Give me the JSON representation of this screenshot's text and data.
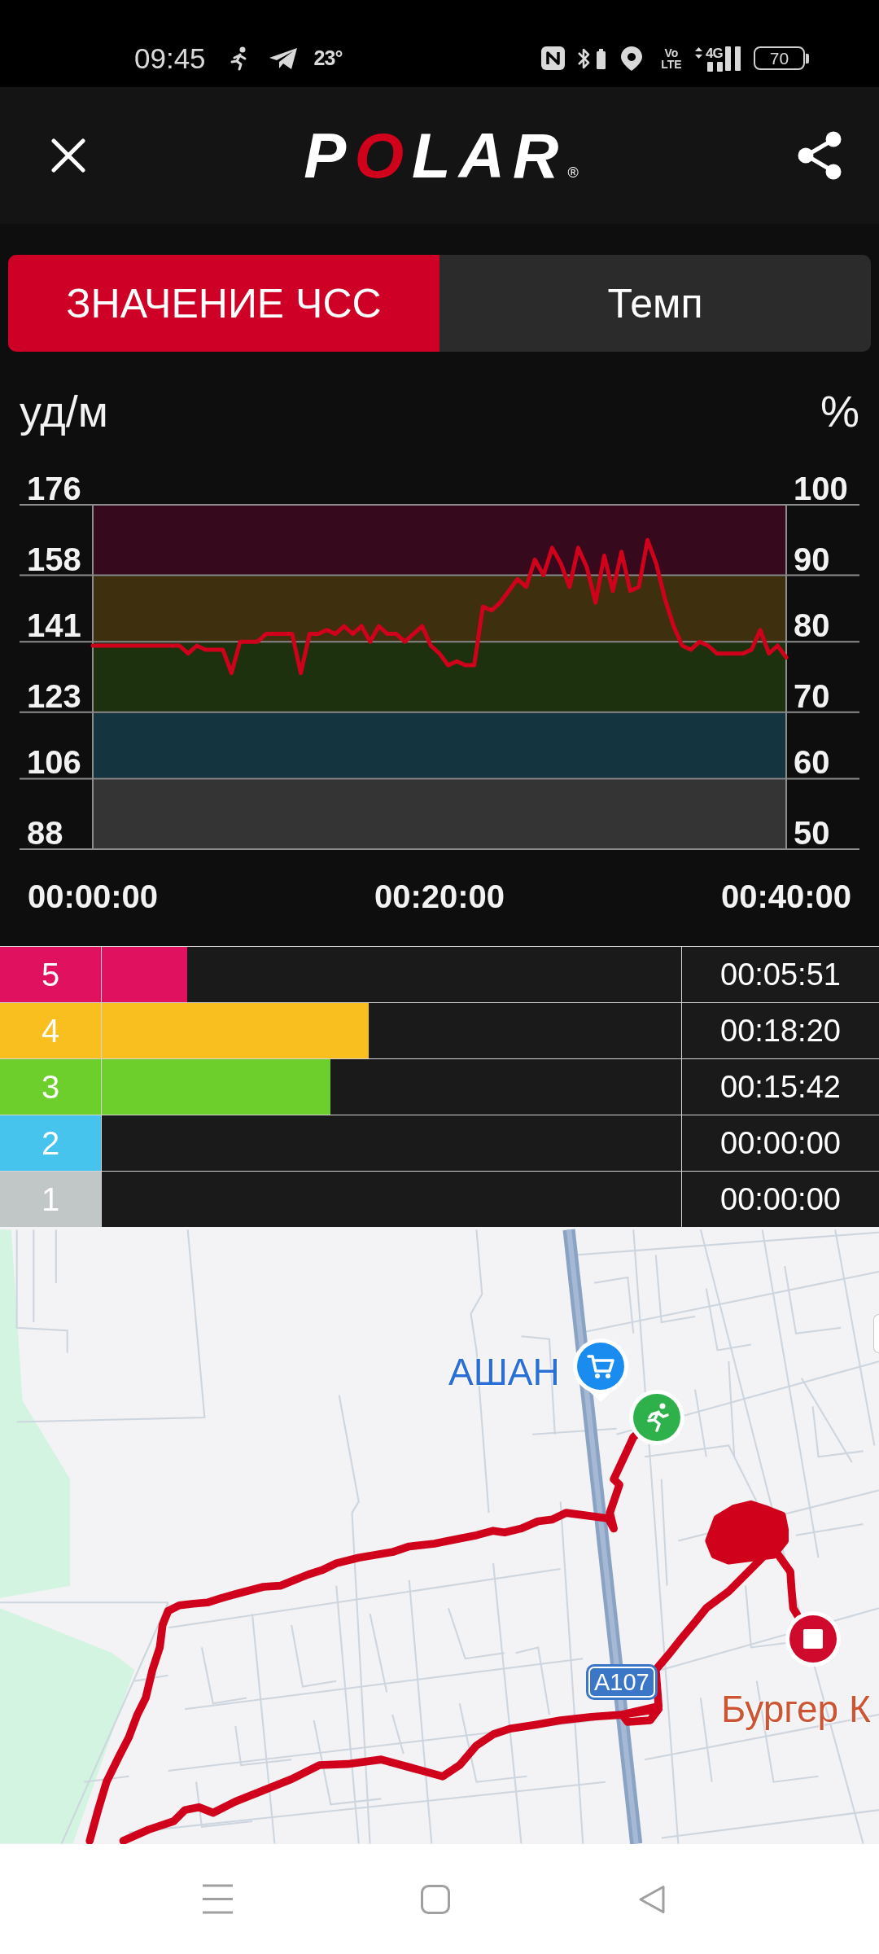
{
  "status_bar": {
    "time": "09:45",
    "temperature": "23°",
    "volte": "Vo LTE",
    "network": "4G",
    "battery": "70"
  },
  "header": {
    "logo": {
      "parts": [
        {
          "text": "P",
          "color": "#ffffff"
        },
        {
          "text": "O",
          "color": "#d0021b"
        },
        {
          "text": "LAR",
          "color": "#ffffff"
        }
      ],
      "mark": "®"
    }
  },
  "tabs": [
    {
      "label": "ЗНАЧЕНИЕ ЧСС",
      "selected": true
    },
    {
      "label": "Темп",
      "selected": false
    }
  ],
  "hr_chart": {
    "right_axis": {
      "label": "%",
      "ticks": [
        "100",
        "90",
        "80",
        "70",
        "60",
        "50"
      ]
    },
    "chart_data": {
      "type": "line",
      "ylabel": "уд/м",
      "x": [
        0,
        0.5,
        1,
        1.5,
        2,
        2.5,
        3,
        3.5,
        4,
        4.5,
        5,
        5.5,
        6,
        6.5,
        7,
        7.5,
        8,
        8.5,
        9,
        9.5,
        10,
        10.5,
        11,
        11.5,
        12,
        12.5,
        13,
        13.5,
        14,
        14.5,
        15,
        15.5,
        16,
        16.5,
        17,
        17.5,
        18,
        18.5,
        19,
        19.5,
        20,
        20.5,
        21,
        21.5,
        22,
        22.5,
        23,
        23.5,
        24,
        24.5,
        25,
        25.5,
        26,
        26.5,
        27,
        27.5,
        28,
        28.5,
        29,
        29.5,
        30,
        30.5,
        31,
        31.5,
        32,
        32.5,
        33,
        33.5,
        34,
        34.5,
        35,
        35.5,
        36,
        36.5,
        37,
        37.5,
        38,
        38.5,
        39,
        39.5,
        40
      ],
      "series": [
        {
          "color": "#d0021b",
          "values": [
            140,
            140,
            140,
            140,
            140,
            140,
            140,
            140,
            140,
            140,
            140,
            138,
            140,
            139,
            139,
            139,
            133,
            141,
            141,
            141,
            143,
            143,
            143,
            143,
            133,
            143,
            143,
            144,
            143,
            145,
            143,
            145,
            141,
            145,
            143,
            143,
            141,
            143,
            145,
            140,
            138,
            135,
            136,
            135,
            135,
            150,
            149,
            151,
            154,
            157,
            155,
            162,
            158,
            165,
            161,
            155,
            165,
            160,
            151,
            163,
            154,
            164,
            154,
            155,
            167,
            161,
            152,
            145,
            140,
            139,
            141,
            140,
            138,
            138,
            138,
            138,
            139,
            144,
            138,
            140,
            137
          ]
        }
      ],
      "xlim": [
        0,
        40
      ],
      "ylim": [
        88,
        176
      ],
      "xticks": [
        {
          "value": 0,
          "label": "00:00:00"
        },
        {
          "value": 20,
          "label": "00:20:00"
        },
        {
          "value": 40,
          "label": "00:40:00"
        }
      ],
      "yticks": [
        88,
        106,
        123,
        141,
        158,
        176
      ],
      "grid": true,
      "bands": [
        {
          "axis": "y",
          "from": 158,
          "to": 176,
          "color": "#36091c"
        },
        {
          "axis": "y",
          "from": 141,
          "to": 158,
          "color": "#3e300e"
        },
        {
          "axis": "y",
          "from": 123,
          "to": 141,
          "color": "#1e310e"
        },
        {
          "axis": "y",
          "from": 106,
          "to": 123,
          "color": "#14343f"
        },
        {
          "axis": "y",
          "from": 88,
          "to": 106,
          "color": "#343434"
        }
      ]
    }
  },
  "zones": [
    {
      "zone": "5",
      "color": "#e0115f",
      "level": 0.147,
      "time": "00:05:51"
    },
    {
      "zone": "4",
      "color": "#f9bf1e",
      "level": 0.46,
      "time": "00:18:20"
    },
    {
      "zone": "3",
      "color": "#6ccf2c",
      "level": 0.394,
      "time": "00:15:42"
    },
    {
      "zone": "2",
      "color": "#46c4ee",
      "time": "00:00:00"
    },
    {
      "zone": "1",
      "color": "#c1c7c7",
      "time": "00:00:00"
    }
  ],
  "map": {
    "labels": [
      {
        "kind": "place",
        "text": "АШАН",
        "color": "#2a6fd6"
      },
      {
        "kind": "shield",
        "text": "A107"
      },
      {
        "kind": "place",
        "text": "Бургер К",
        "color": "#cc5634"
      }
    ]
  }
}
